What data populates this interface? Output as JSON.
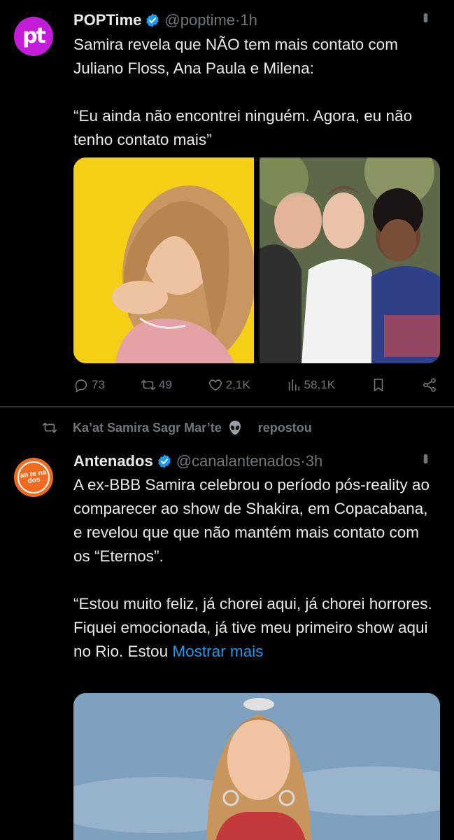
{
  "colors": {
    "background": "#000000",
    "text": "#e7e9ea",
    "muted": "#71767b",
    "link": "#1d9bf0",
    "verified": "#1d9bf0",
    "divider": "#2f3336"
  },
  "tweets": [
    {
      "avatar_text": "pt",
      "name": "POPTime",
      "handle": "@poptime",
      "sep": " · ",
      "time": "1h",
      "text": "Samira revela que NÃO tem mais contato com Juliano Floss, Ana Paula e Milena:\n\n“Eu ainda não encontrei ninguém. Agora, eu não tenho contato mais”",
      "actions": {
        "replies": "73",
        "reposts": "49",
        "likes": "2,1K",
        "views": "58,1K"
      },
      "icons": [
        "reply-icon",
        "repost-icon",
        "like-icon",
        "views-icon",
        "bookmark-icon",
        "share-icon"
      ]
    },
    {
      "reposted_by": "Ka’at Samira Sagr Mar’te",
      "reposted_suffix": "repostou",
      "avatar_text": "an te na dos",
      "name": "Antenados",
      "handle": "@canalantenados",
      "sep": " · ",
      "time": "3h",
      "text": "A ex-BBB Samira celebrou o período pós-reality ao comparecer ao show de Shakira, em Copacabana, e revelou que que não mantém mais contato com os “Eternos”.\n\n“Estou muito feliz, já chorei aqui, já chorei horrores. Fiquei emocionada, já tive meu primeiro show aqui no Rio. Estou ",
      "show_more": "Mostrar mais"
    }
  ]
}
